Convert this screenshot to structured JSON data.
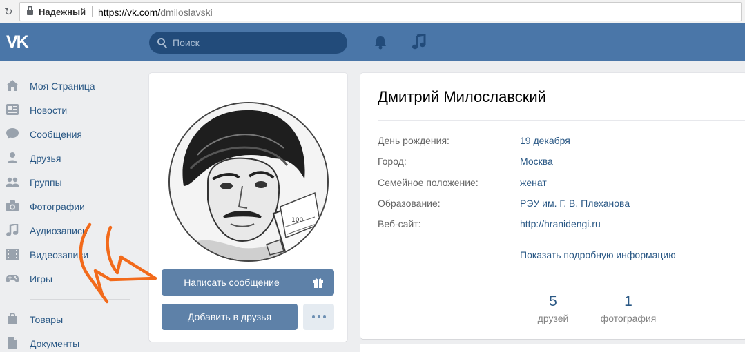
{
  "browser": {
    "secure_label": "Надежный",
    "url_host": "https://vk.com/",
    "url_path": "dmiloslavski"
  },
  "header": {
    "logo_text": "VK",
    "search_placeholder": "Поиск",
    "accent_color": "#4a76a8"
  },
  "sidebar": {
    "items": [
      {
        "label": "Моя Страница",
        "icon": "home-icon"
      },
      {
        "label": "Новости",
        "icon": "news-icon"
      },
      {
        "label": "Сообщения",
        "icon": "messages-icon"
      },
      {
        "label": "Друзья",
        "icon": "friends-icon"
      },
      {
        "label": "Группы",
        "icon": "groups-icon"
      },
      {
        "label": "Фотографии",
        "icon": "camera-icon"
      },
      {
        "label": "Аудиозаписи",
        "icon": "music-icon"
      },
      {
        "label": "Видеозаписи",
        "icon": "video-icon"
      },
      {
        "label": "Игры",
        "icon": "gamepad-icon"
      },
      {
        "label": "Товары",
        "icon": "shopping-bag-icon"
      },
      {
        "label": "Документы",
        "icon": "document-icon"
      }
    ]
  },
  "profile": {
    "name": "Дмитрий Милославский",
    "actions": {
      "write_message": "Написать сообщение",
      "add_friend": "Добавить в друзья"
    },
    "info": [
      {
        "label": "День рождения:",
        "value": "19 декабря"
      },
      {
        "label": "Город:",
        "value": "Москва"
      },
      {
        "label": "Семейное положение:",
        "value": "женат"
      },
      {
        "label": "Образование:",
        "value": "РЭУ им. Г. В. Плеханова"
      },
      {
        "label": "Веб-сайт:",
        "value": "http://hranidengi.ru"
      }
    ],
    "show_more": "Показать подробную информацию",
    "counters": [
      {
        "number": "5",
        "label": "друзей"
      },
      {
        "number": "1",
        "label": "фотография"
      }
    ]
  }
}
